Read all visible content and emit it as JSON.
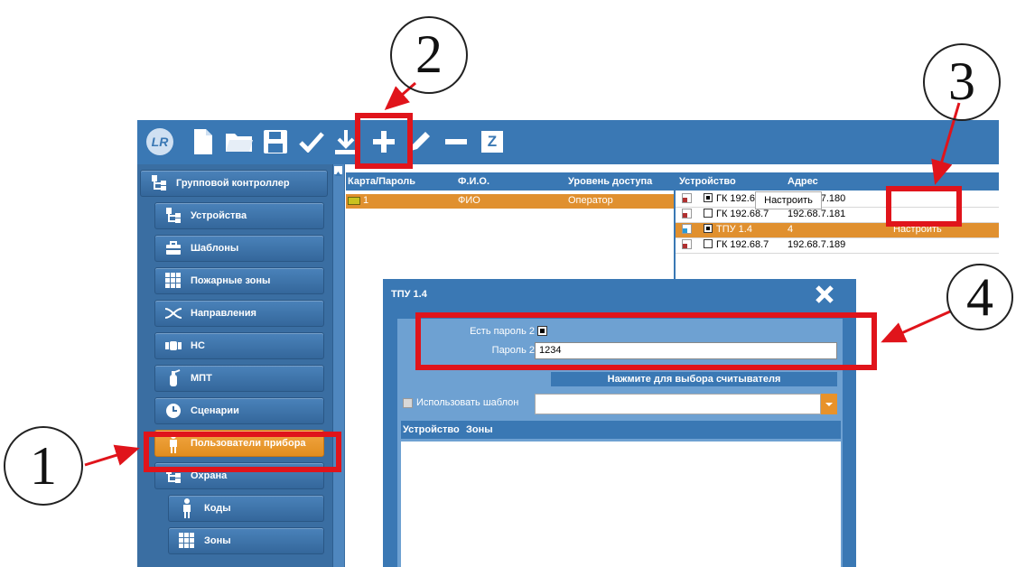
{
  "colors": {
    "toolbar": "#3a78b4",
    "sidebar": "#3a6ea2",
    "accent_orange": "#e0902f",
    "highlight_red": "#e0141b"
  },
  "toolbar": {
    "icons": [
      "logo-icon",
      "new-file-icon",
      "open-folder-icon",
      "save-icon",
      "check-icon",
      "download-icon",
      "plus-icon",
      "edit-pencil-icon",
      "minus-icon",
      "z-icon"
    ],
    "z_label": "Z"
  },
  "sidebar": {
    "items": [
      {
        "label": "Групповой контроллер",
        "icon": "tree-icon"
      },
      {
        "label": "Устройства",
        "icon": "tree-icon"
      },
      {
        "label": "Шаблоны",
        "icon": "briefcase-icon"
      },
      {
        "label": "Пожарные зоны",
        "icon": "grid-icon"
      },
      {
        "label": "Направления",
        "icon": "shuffle-icon"
      },
      {
        "label": "НС",
        "icon": "pump-icon"
      },
      {
        "label": "МПТ",
        "icon": "extinguisher-icon"
      },
      {
        "label": "Сценарии",
        "icon": "clock-icon"
      },
      {
        "label": "Пользователи прибора",
        "icon": "person-icon"
      },
      {
        "label": "Охрана",
        "icon": "tree-icon"
      },
      {
        "label": "Коды",
        "icon": "person-icon"
      },
      {
        "label": "Зоны",
        "icon": "grid-icon"
      }
    ]
  },
  "users_table": {
    "columns": [
      "Карта/Пароль",
      "Ф.И.О.",
      "Уровень доступа"
    ],
    "rows": [
      {
        "card": "1",
        "name": "ФИО",
        "level": "Оператор"
      }
    ]
  },
  "devices_table": {
    "columns": [
      "Устройство",
      "Адрес"
    ],
    "rows": [
      {
        "checked": true,
        "device": "ГК 192.68.7",
        "address": "192.68.7.180",
        "action": "Настроить"
      },
      {
        "checked": false,
        "device": "ГК 192.68.7",
        "address": "192.68.7.181",
        "action": ""
      },
      {
        "checked": true,
        "device": "ТПУ 1.4",
        "address": "4",
        "action": "Настроить"
      },
      {
        "checked": false,
        "device": "ГК 192.68.7",
        "address": "192.68.7.189",
        "action": ""
      }
    ]
  },
  "dialog": {
    "title": "ТПУ 1.4",
    "close_icon": "close-x-icon",
    "has_password2_label": "Есть пароль 2",
    "has_password2_checked": true,
    "password2_label": "Пароль 2",
    "password2_value": "1234",
    "select_reader_label": "Нажмите для выбора считывателя",
    "use_template_label": "Использовать шаблон",
    "use_template_checked": false,
    "zones_headers": [
      "Устройство",
      "Зоны"
    ]
  },
  "annotations": {
    "n1": "1",
    "n2": "2",
    "n3": "3",
    "n4": "4"
  }
}
